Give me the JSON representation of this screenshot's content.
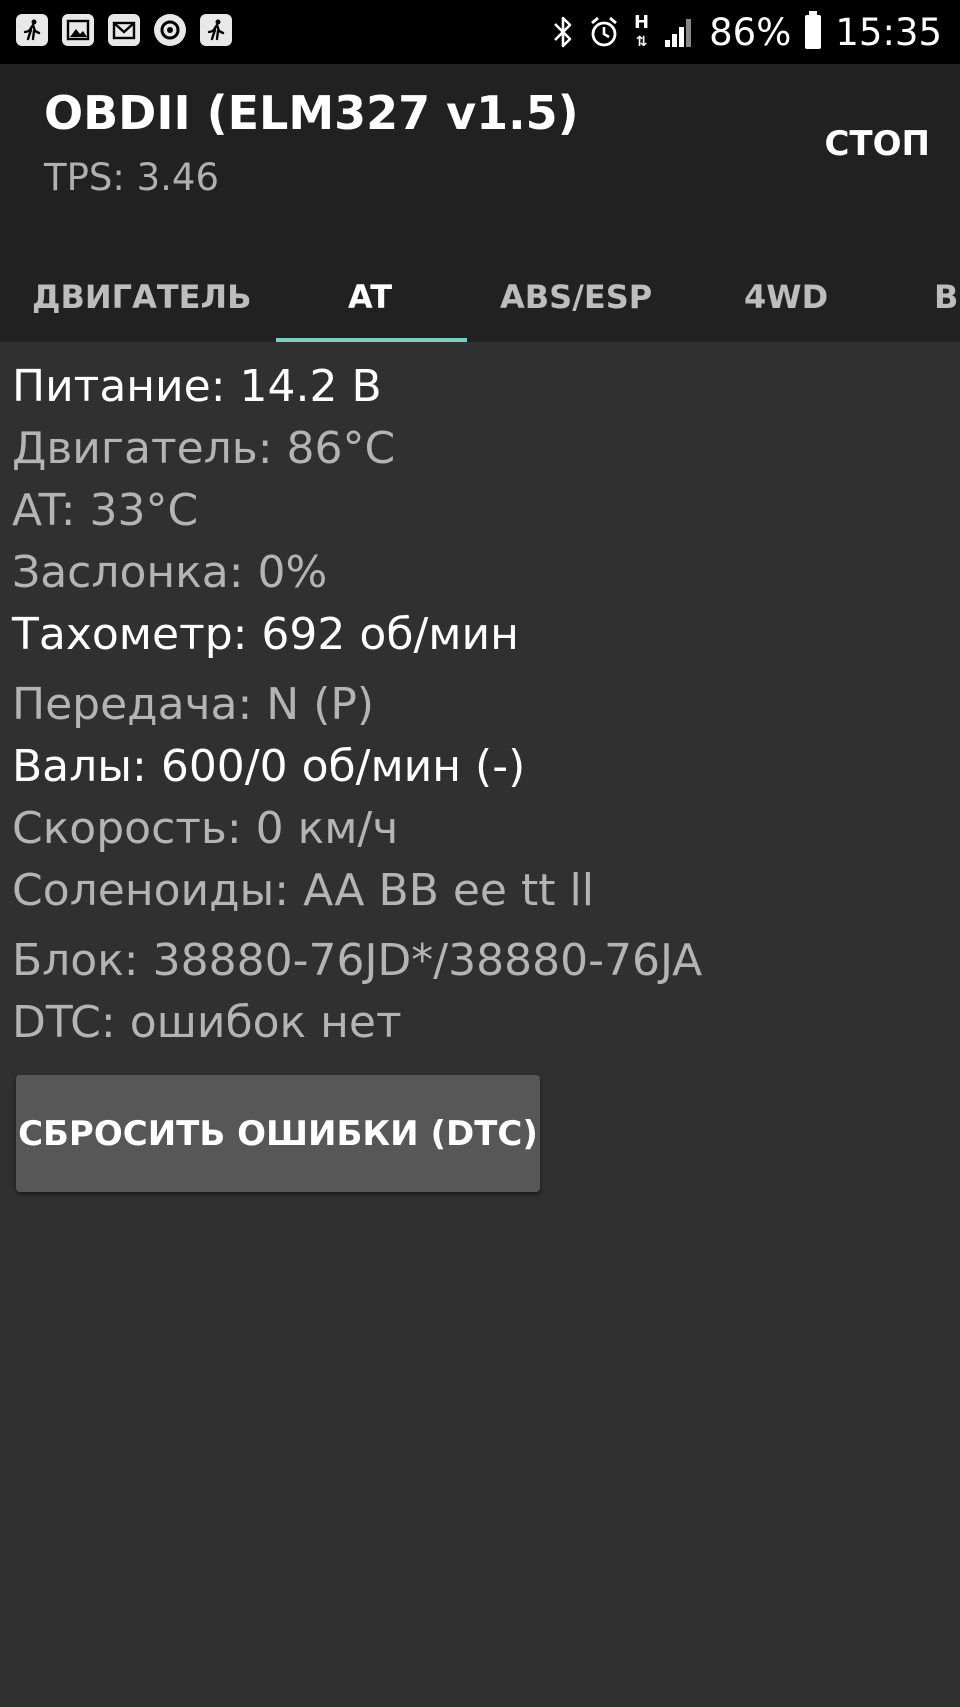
{
  "status_bar": {
    "notifications": [
      "runner-icon",
      "image-icon",
      "mail-icon",
      "circle-arrows-icon",
      "runner-icon"
    ],
    "network_type": "H",
    "battery": "86%",
    "time": "15:35"
  },
  "appbar": {
    "title": "OBDII (ELM327 v1.5)",
    "subtitle": "TPS: 3.46",
    "action": "СТОП"
  },
  "tabs": [
    {
      "label": "ДВИГАТЕЛЬ"
    },
    {
      "label": "AT"
    },
    {
      "label": "ABS/ESP"
    },
    {
      "label": "4WD"
    },
    {
      "label": "BC"
    }
  ],
  "readings": [
    {
      "text": "Питание: 14.2 В"
    },
    {
      "text": "Двигатель: 86°C"
    },
    {
      "text": "AT: 33°C"
    },
    {
      "text": "Заслонка: 0%"
    },
    {
      "text": "Тахометр: 692 об/мин"
    },
    {
      "text": "Передача: N (P)"
    },
    {
      "text": "Валы: 600/0 об/мин (-)"
    },
    {
      "text": "Скорость: 0 км/ч"
    },
    {
      "text": "Соленоиды: AA BB ee tt ll"
    },
    {
      "text": "Блок: 38880-76JD*/38880-76JA"
    },
    {
      "text": "DTC: ошибок нет"
    }
  ],
  "reset_button": "СБРОСИТЬ ОШИБКИ (DTC)",
  "colors": {
    "background": "#303030",
    "appbar": "#212121",
    "tab_indicator": "#7ccdc4",
    "button": "#575757"
  }
}
